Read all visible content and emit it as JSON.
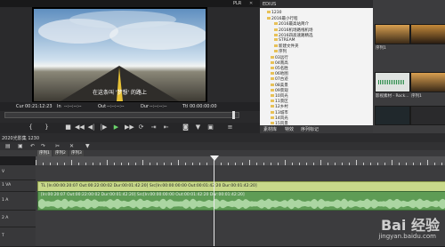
{
  "player": {
    "title_right": "PLR",
    "subtitle": "在这条叫 '梦想' 的路上",
    "timecodes": {
      "cur_label": "Cur",
      "cur": "00:21:12:23",
      "in_label": "In",
      "in": "--:--:--:--",
      "out_label": "Out",
      "out": "--:--:--:--",
      "dur_label": "Dur",
      "dur": "--:--:--:--",
      "ttl_label": "Ttl",
      "ttl": "00:00:00:00"
    }
  },
  "folders": {
    "title": "EDIUS",
    "tree": [
      "1230",
      "2016最小行程",
      "2016最高站简介",
      "2016机场路线机场",
      "2016四高速路精选",
      "STREAM",
      "新建文件夹",
      "序列",
      "03远行",
      "04南高",
      "05名胜",
      "06地图",
      "07古迹",
      "08美景",
      "09景观",
      "10风光",
      "11景区",
      "12乡村",
      "13城市",
      "14风光",
      "15风景"
    ],
    "tabs": [
      "素材库",
      "特效",
      "序列标记"
    ]
  },
  "clips": {
    "labels": [
      "序列1",
      "序列1",
      "影视素材 - Rock...",
      "序列1"
    ]
  },
  "timeline": {
    "label": "2020光影集 1230",
    "seq_tabs": [
      "序列1",
      "序列2",
      "序列3"
    ],
    "tracks": [
      "V",
      "1 VA",
      "1 A",
      "2 A",
      "T"
    ],
    "video_clip": "TL [In:00:00:20:07 Out:00:22:00:02 Dur:00:01:42:20]  Src[In:00:00:00:00 Out:00:01:42:20 Dur:00:01:42:20]",
    "audio_clip": "[In:00:20:07 Out:00:22:00:02 Dur:00:01:42:20]  Src[In:00:00:00:00 Out:00:01:42:20 Dur:00:01:42:20]"
  },
  "watermark": {
    "big": "Bai 经验",
    "url": "jingyan.baidu.com"
  }
}
